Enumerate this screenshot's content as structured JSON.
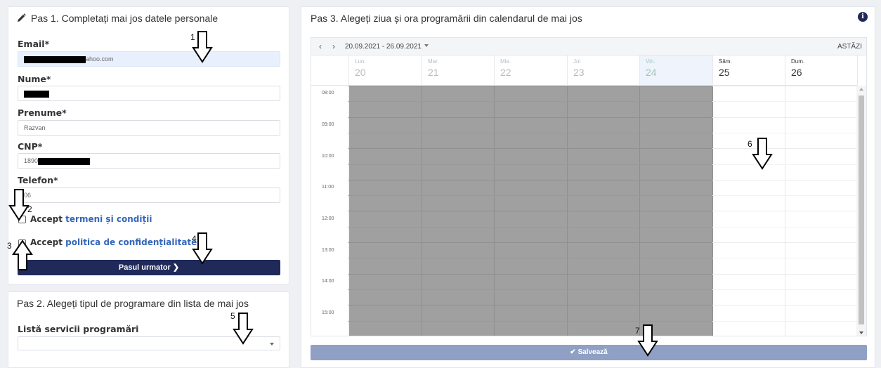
{
  "step1": {
    "title": "Pas 1. Completați mai jos datele personale",
    "email_label": "Email*",
    "email_value": "ahoo.com",
    "nume_label": "Nume*",
    "prenume_label": "Prenume*",
    "prenume_value": "Razvan",
    "cnp_label": "CNP*",
    "cnp_value": "1890",
    "telefon_label": "Telefon*",
    "telefon_value": "06",
    "accept1_prefix": "Accept ",
    "accept1_link": "termeni și condiții",
    "accept2_prefix": "Accept ",
    "accept2_link": "politica de confidențialitate",
    "next_button": "Pasul urmator ❯"
  },
  "step2": {
    "title": "Pas 2. Alegeți tipul de programare din lista de mai jos",
    "services_label": "Listă servicii programări",
    "services_value": ""
  },
  "step3": {
    "title": "Pas 3. Alegeți ziua și ora programării din calendarul de mai jos",
    "range": "20.09.2021 - 26.09.2021",
    "today_button": "ASTĂZI",
    "days": [
      {
        "name": "Lun.",
        "num": "20"
      },
      {
        "name": "Mar.",
        "num": "21"
      },
      {
        "name": "Mie.",
        "num": "22"
      },
      {
        "name": "Joi",
        "num": "23"
      },
      {
        "name": "Vin.",
        "num": "24"
      },
      {
        "name": "Sâm.",
        "num": "25"
      },
      {
        "name": "Dum.",
        "num": "26"
      }
    ],
    "times": [
      "08:00",
      "09:00",
      "10:00",
      "11:00",
      "12:00",
      "13:00",
      "14:00",
      "15:00"
    ],
    "save_button": "✔ Salvează"
  },
  "annotations": [
    "1",
    "2",
    "3",
    "4",
    "5",
    "6",
    "7"
  ],
  "colors": {
    "primary": "#1f2a5a",
    "link": "#3466b8",
    "save_disabled": "#8fa0c4",
    "unavailable": "#a0a0a0",
    "autofill": "#e8f0fe"
  }
}
